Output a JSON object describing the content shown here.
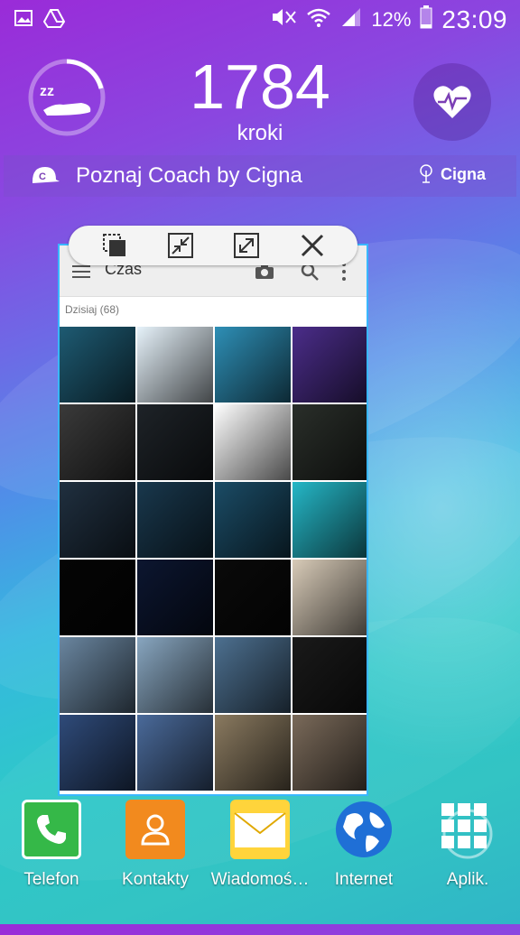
{
  "status_bar": {
    "left_icons": [
      "gallery-icon",
      "drive-icon"
    ],
    "right_icons": [
      "mute-icon",
      "wifi-icon",
      "signal-icon",
      "battery-icon"
    ],
    "battery": "12%",
    "time": "23:09"
  },
  "widget": {
    "steps": "1784",
    "steps_label": "kroki",
    "coach_text": "Poznaj Coach by Cigna",
    "brand": "Cigna"
  },
  "popup": {
    "controls": [
      "switch-window-icon",
      "minimize-icon",
      "maximize-icon",
      "close-icon"
    ],
    "app_title": "Czas",
    "section_header": "Dzisiaj (68)",
    "thumb_colors": [
      [
        "#1e5b73",
        "#e6f2fa",
        "#2e8fb6",
        "#4b2d8a"
      ],
      [
        "#3a3a3a",
        "#1e2328",
        "#ffffff",
        "#2a2f2a"
      ],
      [
        "#203040",
        "#19384d",
        "#1b4c66",
        "#25b7c7"
      ],
      [
        "#050505",
        "#0c1630",
        "#0a0a0a",
        "#d8cbb8"
      ],
      [
        "#6a86a0",
        "#88a6c0",
        "#4d7090",
        "#1a1a1a"
      ],
      [
        "#2f4b7a",
        "#4a6a9a",
        "#8a7a60",
        "#7a6a5a"
      ]
    ]
  },
  "dock": {
    "items": [
      {
        "label": "Telefon",
        "icon": "phone-icon"
      },
      {
        "label": "Kontakty",
        "icon": "contacts-icon"
      },
      {
        "label": "Wiadomoś…",
        "icon": "messages-icon"
      },
      {
        "label": "Internet",
        "icon": "internet-icon"
      },
      {
        "label": "Aplik.",
        "icon": "apps-icon"
      }
    ]
  }
}
